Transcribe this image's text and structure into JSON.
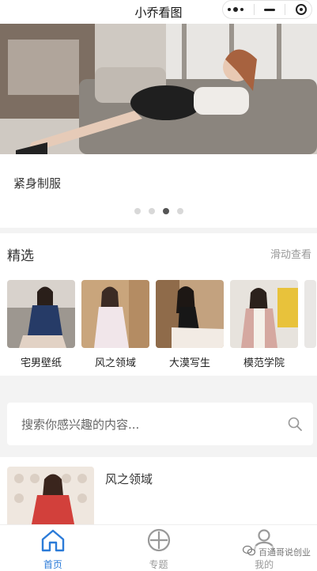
{
  "app": {
    "title": "小乔看图"
  },
  "banner": {
    "caption": "紧身制服",
    "dots_total": 4,
    "active_dot": 3
  },
  "featured": {
    "title": "精选",
    "more": "滑动查看",
    "items": [
      {
        "label": "宅男壁纸"
      },
      {
        "label": "风之领域"
      },
      {
        "label": "大漠写生"
      },
      {
        "label": "模范学院"
      }
    ]
  },
  "search": {
    "placeholder": "搜索你感兴趣的内容..."
  },
  "list": [
    {
      "title": "风之领域"
    }
  ],
  "tabs": [
    {
      "label": "首页",
      "icon": "home-icon",
      "active": true
    },
    {
      "label": "专题",
      "icon": "plus-circle-icon",
      "active": false
    },
    {
      "label": "我的",
      "icon": "person-icon",
      "active": false
    }
  ],
  "watermark": {
    "text": "百通哥说创业"
  },
  "colors": {
    "accent": "#2b7bd8",
    "inactive": "#999999"
  }
}
